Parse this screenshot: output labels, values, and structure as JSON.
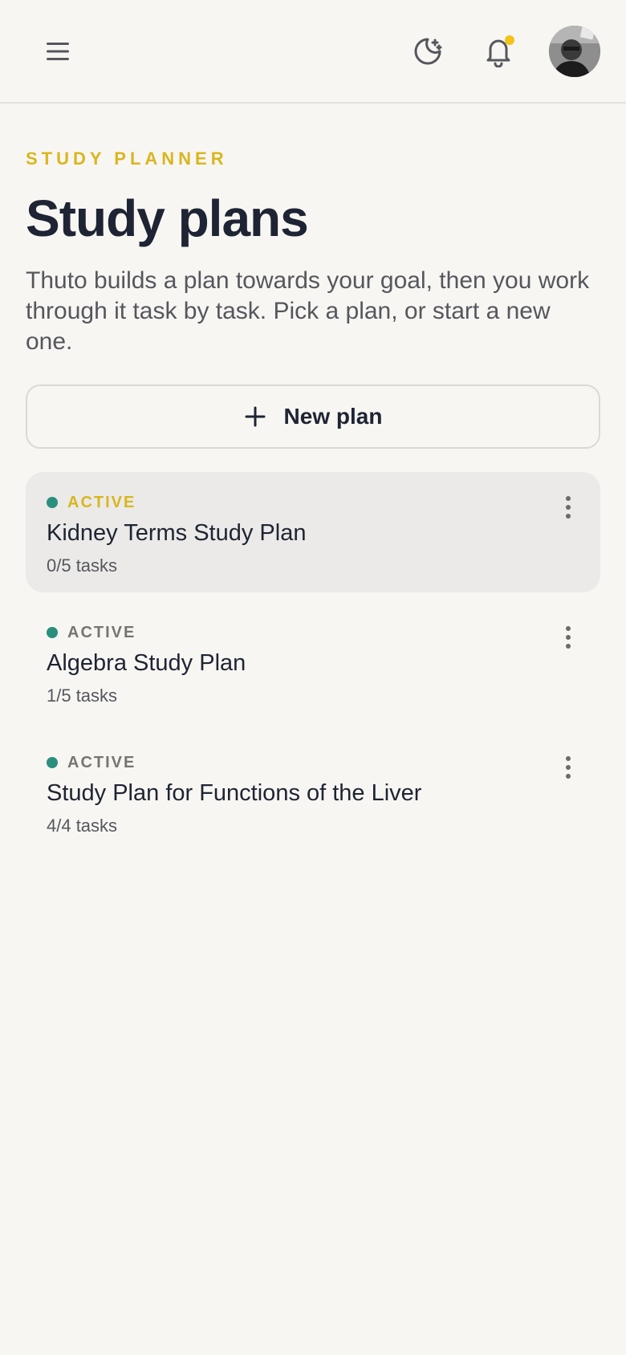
{
  "header": {
    "menu_icon": "hamburger-menu-icon",
    "theme_icon": "moon-stars-icon",
    "notification_icon": "bell-icon",
    "notification_dot_color": "#f2c318",
    "avatar_icon": "user-avatar"
  },
  "page": {
    "eyebrow": "STUDY PLANNER",
    "title": "Study plans",
    "subtitle": "Thuto builds a plan towards your goal, then you work through it task by task. Pick a plan, or start a new one."
  },
  "new_plan": {
    "label": "New plan",
    "icon": "plus-icon"
  },
  "plans": [
    {
      "status": "ACTIVE",
      "title": "Kidney Terms Study Plan",
      "tasks": "0/5 tasks",
      "selected": true
    },
    {
      "status": "ACTIVE",
      "title": "Algebra Study Plan",
      "tasks": "1/5 tasks",
      "selected": false
    },
    {
      "status": "ACTIVE",
      "title": "Study Plan for Functions of the Liver",
      "tasks": "4/4 tasks",
      "selected": false
    }
  ],
  "colors": {
    "accent": "#d9b61e",
    "status_dot": "#2a8f7e",
    "status_text_muted": "#77756f",
    "background": "#f8f6f3",
    "selected_card": "#ebeae8"
  }
}
